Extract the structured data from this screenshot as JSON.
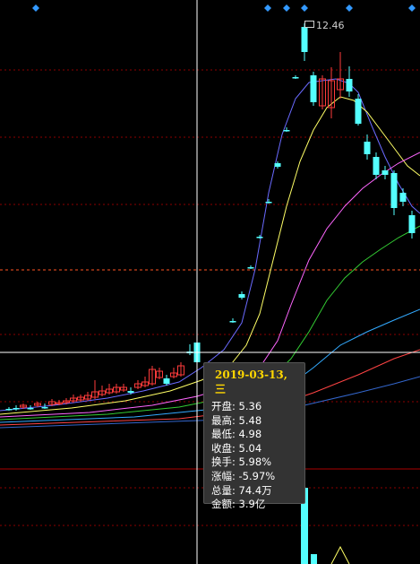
{
  "colors": {
    "background": "#000000",
    "up_candle": "#ff3b3b",
    "down_candle": "#54ffff",
    "crosshair": "#ffffff",
    "ma5": "#6a6aff",
    "ma10": "#ffff66",
    "ma20": "#ff66ff",
    "ma30": "#33cc33",
    "ma60": "#33aaff",
    "ma120": "#ff4444",
    "ma250": "#3366cc",
    "grid": "#8b0000",
    "tooltip_date": "#ffd700",
    "marker": "#3399ff"
  },
  "chart": {
    "max_price_label": "12.46"
  },
  "tooltip": {
    "date": "2019-03-13,三",
    "rows": [
      {
        "label": "开盘",
        "value": "5.36"
      },
      {
        "label": "最高",
        "value": "5.48"
      },
      {
        "label": "最低",
        "value": "4.98"
      },
      {
        "label": "收盘",
        "value": "5.04"
      },
      {
        "label": "换手",
        "value": "5.98%"
      },
      {
        "label": "涨幅",
        "value": "-5.97%"
      },
      {
        "label": "总量",
        "value": "74.4万"
      },
      {
        "label": "金额",
        "value": "3.9亿"
      }
    ]
  }
}
